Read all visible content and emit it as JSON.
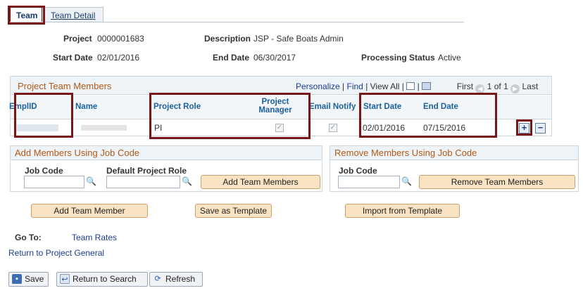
{
  "tabs": [
    {
      "label": "Team"
    },
    {
      "label": "Team Detail"
    }
  ],
  "header": {
    "project_label": "Project",
    "project_value": "0000001683",
    "description_label": "Description",
    "description_value": "JSP - Safe Boats Admin",
    "start_date_label": "Start Date",
    "start_date_value": "02/01/2016",
    "end_date_label": "End Date",
    "end_date_value": "06/30/2017",
    "processing_status_label": "Processing Status",
    "processing_status_value": "Active"
  },
  "team_grid": {
    "title": "Project Team Members",
    "personalize": "Personalize",
    "find": "Find",
    "view_all": "View All",
    "first": "First",
    "pagination": "1 of 1",
    "last": "Last",
    "columns": {
      "emplid": "EmplID",
      "name": "Name",
      "project_role": "Project Role",
      "project_manager": "Project Manager",
      "email_notify": "Email Notify",
      "start_date": "Start Date",
      "end_date": "End Date"
    },
    "rows": [
      {
        "emplid": "",
        "name": "",
        "project_role": "PI",
        "project_manager_checked": true,
        "email_notify_checked": true,
        "start_date": "02/01/2016",
        "end_date": "07/15/2016"
      }
    ],
    "add_row_symbol": "+",
    "delete_row_symbol": "−"
  },
  "add_members": {
    "title": "Add Members Using Job Code",
    "job_code_label": "Job Code",
    "default_role_label": "Default Project Role",
    "add_button": "Add Team Members"
  },
  "remove_members": {
    "title": "Remove Members Using Job Code",
    "job_code_label": "Job Code",
    "remove_button": "Remove Team Members"
  },
  "actions": {
    "add_team_member": "Add Team Member",
    "save_as_template": "Save as Template",
    "import_from_template": "Import from Template"
  },
  "goto": {
    "label": "Go To:",
    "team_rates": "Team Rates",
    "return_link": "Return to Project General"
  },
  "footer": {
    "save": "Save",
    "return_to_search": "Return to Search",
    "refresh": "Refresh"
  },
  "colors": {
    "highlight": "#7a1618",
    "section_title": "#b25a16",
    "link": "#1a3d8f"
  }
}
